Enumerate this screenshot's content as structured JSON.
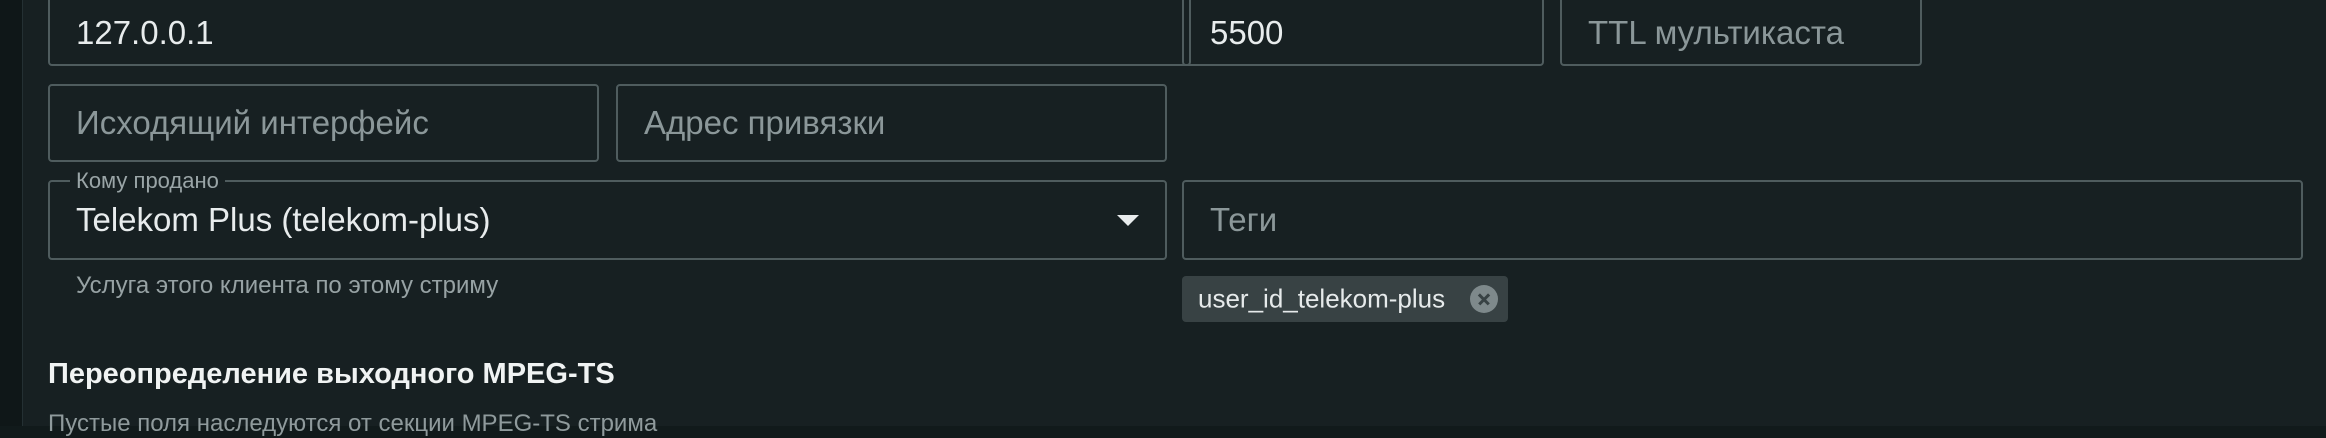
{
  "form": {
    "host": {
      "value": "127.0.0.1",
      "placeholder": ""
    },
    "port": {
      "value": "5500",
      "placeholder": ""
    },
    "multicast_ttl": {
      "value": "",
      "placeholder": "TTL мультикаста"
    },
    "outgoing_interface": {
      "value": "",
      "placeholder": "Исходящий интерфейс"
    },
    "bind_address": {
      "value": "",
      "placeholder": "Адрес привязки"
    },
    "sold_to": {
      "label": "Кому продано",
      "selected": "Telekom Plus (telekom-plus)",
      "helper": "Услуга этого клиента по этому стриму"
    },
    "tags": {
      "placeholder": "Теги",
      "chips": [
        "user_id_telekom-plus"
      ]
    }
  },
  "mpegts_override": {
    "title": "Переопределение выходного MPEG-TS",
    "subtitle": "Пустые поля наследуются от секции MPEG-TS стрима"
  },
  "colors": {
    "background": "#172022",
    "border": "#4f5c5e",
    "chip": "#384244",
    "text": "#e8eced",
    "placeholder": "#8b9799"
  }
}
